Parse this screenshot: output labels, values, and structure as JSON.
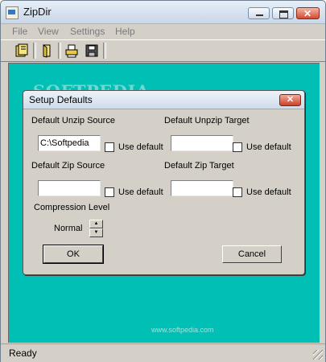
{
  "window": {
    "title": "ZipDir",
    "min_symbol": "",
    "max_symbol": "",
    "close_symbol": "✕"
  },
  "menu": [
    "File",
    "View",
    "Settings",
    "Help"
  ],
  "toolbar": {
    "icons": [
      "open-book-icon",
      "open-file-icon",
      "print-icon",
      "save-icon"
    ]
  },
  "watermark": {
    "brand": "SOFTPEDIA",
    "url": "www.softpedia.com"
  },
  "dialog": {
    "title": "Setup Defaults",
    "close_symbol": "✕",
    "unzip_source_label": "Default Unzip Source",
    "unzip_source_value": "C:\\Softpedia",
    "unzip_target_label": "Default Unpzip Target",
    "unzip_target_value": "",
    "zip_source_label": "Default Zip Source",
    "zip_source_value": "",
    "zip_target_label": "Default Zip Target",
    "zip_target_value": "",
    "use_default_label": "Use default",
    "compression_label": "Compression Level",
    "compression_value": "Normal",
    "ok_label": "OK",
    "cancel_label": "Cancel"
  },
  "status": {
    "text": "Ready"
  }
}
